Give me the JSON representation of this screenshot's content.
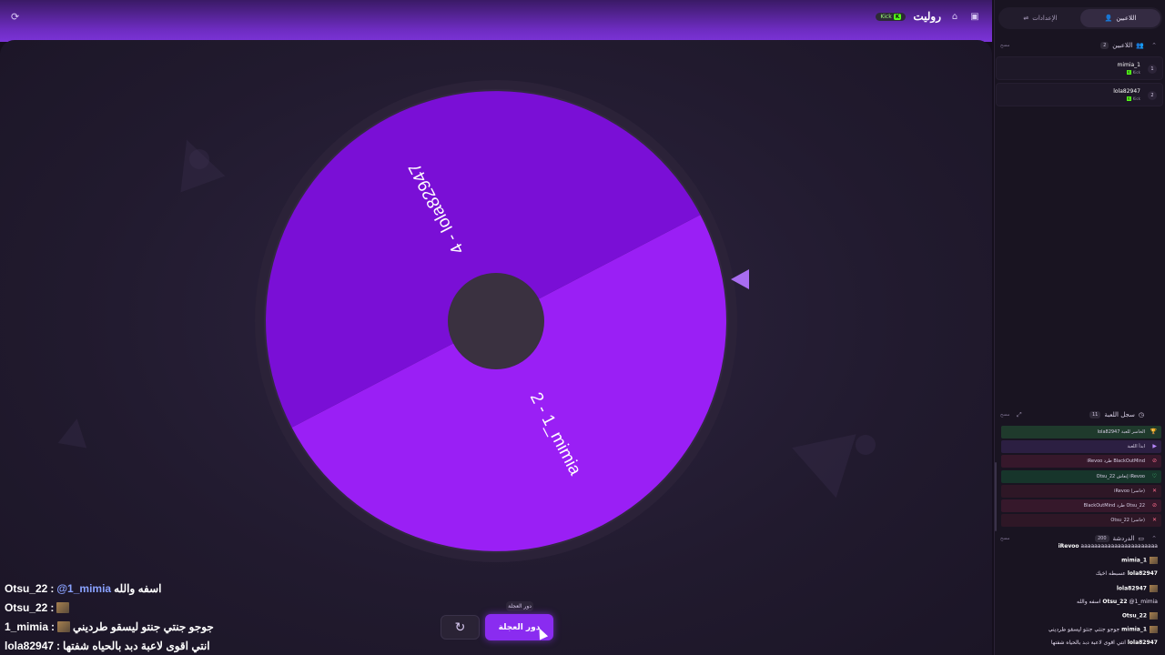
{
  "colors": {
    "accent": "#8a2cf0",
    "segment_light": "#9a1ff5",
    "segment_dark": "#7a0fd6",
    "wheel_hub": "#3a3140",
    "wheel_rim": "#2b2238",
    "kick_green": "#53fc18"
  },
  "topbar": {
    "title": "رولیت",
    "badge": "Kick",
    "icons": [
      "refresh-icon",
      "home-icon",
      "save-icon"
    ]
  },
  "wheel": {
    "segments": [
      {
        "label": "2 - 1_mimia",
        "color": "#9a1ff5"
      },
      {
        "label": "4 - lola82947",
        "color": "#7a0fd6"
      }
    ]
  },
  "controls": {
    "tooltip": "دور العجلة",
    "spin_label": "دور العجلة",
    "reset_icon": "reset-icon"
  },
  "chat_overlay": [
    {
      "user": "Otsu_22",
      "mention": "@1_mimia",
      "text": "اسفه والله",
      "image": false
    },
    {
      "user": "Otsu_22",
      "mention": "",
      "text": "",
      "image": true
    },
    {
      "user": "1_mimia",
      "mention": "",
      "text": "جوجو جنتي جنتو ليسقو طرديني",
      "image": true
    },
    {
      "user": "lola82947",
      "mention": "",
      "text": "انتي اقوى لاعبة دبد بالحياه شفتها",
      "image": false
    }
  ],
  "sidebar": {
    "tabs": [
      {
        "label": "اللاعبين",
        "icon": "users-icon",
        "active": true
      },
      {
        "label": "الإعدادات",
        "icon": "sliders-icon",
        "active": false
      }
    ],
    "players_section": {
      "title": "اللاعبين",
      "count": "2",
      "clear": "مسح"
    },
    "players": [
      {
        "name": "mimia_1",
        "number": "1",
        "platform": "Kick"
      },
      {
        "name": "lola82947",
        "number": "2",
        "platform": "Kick"
      }
    ],
    "log_section": {
      "title": "سجل اللعبة",
      "count": "11",
      "clear": "مسح"
    },
    "log": [
      {
        "text": "lola82947 الخاسر للعبة",
        "icon": "trophy-icon",
        "type": "winner"
      },
      {
        "text": "ابدأ اللعبة",
        "icon": "play-icon",
        "type": "start"
      },
      {
        "text": "iRevoo طرد BlackOutMind",
        "icon": "kick-icon",
        "type": "kick"
      },
      {
        "text": "Otsu_22 إنعاش iRevoo",
        "icon": "shield-icon",
        "type": "revive"
      },
      {
        "text": "iRevoo (خاسر)",
        "icon": "x-icon",
        "type": "out"
      },
      {
        "text": "BlackOutMind طرد Otsu_22",
        "icon": "kick-icon",
        "type": "kick"
      },
      {
        "text": "Otsu_22 (خاسر)",
        "icon": "x-icon",
        "type": "out"
      }
    ],
    "chat_section": {
      "title": "الدردشة",
      "count": "200",
      "clear": "مسح"
    },
    "chat": [
      {
        "user": "iRevoo",
        "text": "aaaaaaaaaaaaaaaaaaaaaaa",
        "avatar": false
      },
      {
        "user": "mimia_1",
        "text": "",
        "avatar": true
      },
      {
        "user": "lola82947",
        "text": "عسبطه اخيك",
        "avatar": false
      },
      {
        "user": "lola82947",
        "text": "",
        "avatar": true
      },
      {
        "user": "Otsu_22",
        "text": "@1_mimia اسفه والله",
        "avatar": false
      },
      {
        "user": "Otsu_22",
        "text": "",
        "avatar": true
      },
      {
        "user": "mimia_1",
        "text": "جوجو جنتي جنتو ليسقو طرديني",
        "avatar": true
      },
      {
        "user": "lola82947",
        "text": "انتي اقوى لاعبة دبد بالحياه شفتها",
        "avatar": false
      }
    ]
  }
}
